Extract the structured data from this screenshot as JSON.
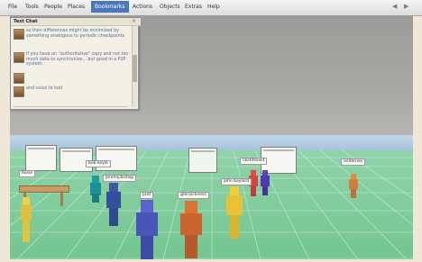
{
  "menubar": {
    "items": [
      {
        "label": "File",
        "active": false
      },
      {
        "label": "Tools",
        "active": false
      },
      {
        "label": "People",
        "active": false
      },
      {
        "label": "Places",
        "active": false
      },
      {
        "label": "Bookmarks",
        "active": true
      },
      {
        "label": "Actions",
        "active": false
      },
      {
        "label": "Objects",
        "active": false
      },
      {
        "label": "Extras",
        "active": false
      },
      {
        "label": "Help",
        "active": false
      }
    ],
    "back_icon": "triangle-left",
    "forward_icon": "triangle-right"
  },
  "chat": {
    "title": "Text Chat",
    "close_label": "×",
    "messages": [
      {
        "text": "so then differences might be minimized by something analogous to periodic checkpoints",
        "big": "checkpoints"
      },
      {
        "text": "if you have an \"authoritative\" copy and not too much data to synchronize... but good in a P2P system.",
        "big": ""
      },
      {
        "text": "",
        "big": ""
      },
      {
        "text": "and voice to text",
        "big": ""
      }
    ]
  },
  "scene": {
    "name_tags": [
      "Rosie",
      "bob keyle",
      "jeremy.bishop",
      "prot",
      "gmcsickness",
      "john boylard",
      "cbstifesaid",
      "andernes"
    ]
  }
}
